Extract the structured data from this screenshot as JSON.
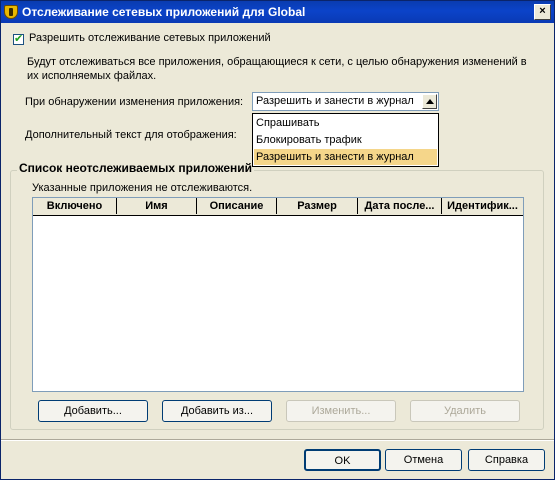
{
  "window": {
    "title": "Отслеживание сетевых приложений для Global",
    "close_glyph": "×"
  },
  "enable_checkbox": {
    "label": "Разрешить отслеживание сетевых приложений",
    "checked": true
  },
  "description": "Будут отслеживаться все приложения, обращающиеся к сети, с целью обнаружения изменений в их исполняемых файлах.",
  "on_change": {
    "label": "При обнаружении изменения приложения:",
    "selected": "Разрешить и занести в журнал",
    "options": [
      "Спрашивать",
      "Блокировать трафик",
      "Разрешить и занести в журнал"
    ],
    "highlighted_index": 2,
    "highlight_color": "#f5d68a"
  },
  "extra_text": {
    "label": "Дополнительный текст для отображения:"
  },
  "unmonitored": {
    "title": "Список неотслеживаемых приложений",
    "note": "Указанные приложения не отслеживаются.",
    "columns": [
      "Включено",
      "Имя",
      "Описание",
      "Размер",
      "Дата после...",
      "Идентифик..."
    ],
    "rows": []
  },
  "buttons": {
    "add": "Добавить...",
    "add_from": "Добавить из...",
    "edit": "Изменить...",
    "delete": "Удалить",
    "ok": "OK",
    "cancel": "Отмена",
    "help": "Справка"
  },
  "colors": {
    "titlebar": "#0b43c9",
    "dialog_bg": "#ece9d8"
  }
}
